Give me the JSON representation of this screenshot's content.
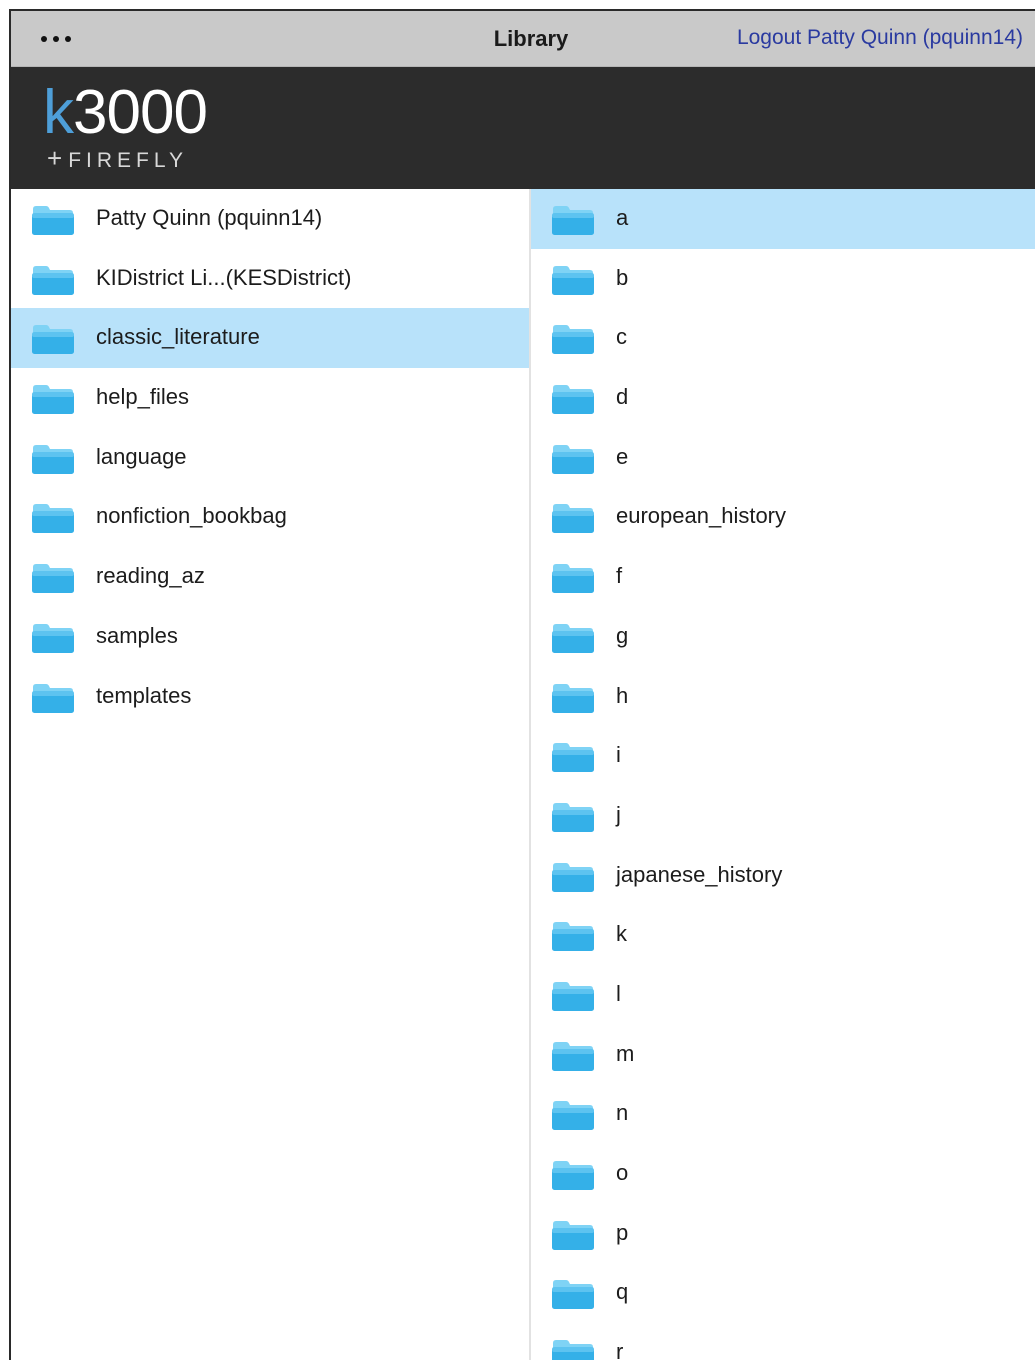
{
  "topbar": {
    "more_icon": "ellipsis-icon",
    "title": "Library",
    "logout_label": "Logout Patty Quinn (pquinn14)"
  },
  "brand": {
    "logo_k": "k",
    "logo_num": "3000",
    "logo_sub": "FIREFLY",
    "logo_plus": "+"
  },
  "left_pane": {
    "items": [
      {
        "label": "Patty Quinn (pquinn14)",
        "icon": "folder-icon",
        "selected": false
      },
      {
        "label": "KIDistrict Li...(KESDistrict)",
        "icon": "folder-icon",
        "selected": false
      },
      {
        "label": "classic_literature",
        "icon": "folder-icon",
        "selected": true
      },
      {
        "label": "help_files",
        "icon": "folder-icon",
        "selected": false
      },
      {
        "label": "language",
        "icon": "folder-icon",
        "selected": false
      },
      {
        "label": "nonfiction_bookbag",
        "icon": "folder-icon",
        "selected": false
      },
      {
        "label": "reading_az",
        "icon": "folder-icon",
        "selected": false
      },
      {
        "label": "samples",
        "icon": "folder-icon",
        "selected": false
      },
      {
        "label": "templates",
        "icon": "folder-icon",
        "selected": false
      }
    ]
  },
  "right_pane": {
    "items": [
      {
        "label": "a",
        "icon": "folder-icon",
        "selected": true
      },
      {
        "label": "b",
        "icon": "folder-icon",
        "selected": false
      },
      {
        "label": "c",
        "icon": "folder-icon",
        "selected": false
      },
      {
        "label": "d",
        "icon": "folder-icon",
        "selected": false
      },
      {
        "label": "e",
        "icon": "folder-icon",
        "selected": false
      },
      {
        "label": "european_history",
        "icon": "folder-icon",
        "selected": false
      },
      {
        "label": "f",
        "icon": "folder-icon",
        "selected": false
      },
      {
        "label": "g",
        "icon": "folder-icon",
        "selected": false
      },
      {
        "label": "h",
        "icon": "folder-icon",
        "selected": false
      },
      {
        "label": "i",
        "icon": "folder-icon",
        "selected": false
      },
      {
        "label": "j",
        "icon": "folder-icon",
        "selected": false
      },
      {
        "label": "japanese_history",
        "icon": "folder-icon",
        "selected": false
      },
      {
        "label": "k",
        "icon": "folder-icon",
        "selected": false
      },
      {
        "label": "l",
        "icon": "folder-icon",
        "selected": false
      },
      {
        "label": "m",
        "icon": "folder-icon",
        "selected": false
      },
      {
        "label": "n",
        "icon": "folder-icon",
        "selected": false
      },
      {
        "label": "o",
        "icon": "folder-icon",
        "selected": false
      },
      {
        "label": "p",
        "icon": "folder-icon",
        "selected": false
      },
      {
        "label": "q",
        "icon": "folder-icon",
        "selected": false
      },
      {
        "label": "r",
        "icon": "folder-icon",
        "selected": false
      }
    ]
  },
  "colors": {
    "topbar_bg": "#c9c9c9",
    "brand_bg": "#2c2c2c",
    "logo_accent": "#4e9fd9",
    "selected_row": "#b8e2fa",
    "logout_link": "#2a3aa0",
    "folder_light": "#7fd3f5",
    "folder_dark": "#34b0e8"
  }
}
